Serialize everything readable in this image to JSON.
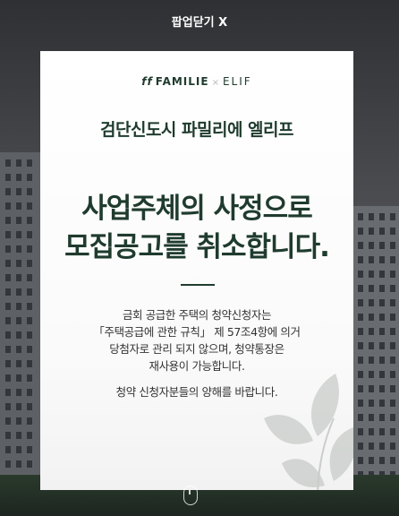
{
  "popup": {
    "close_label": "팝업닫기 X",
    "brand": {
      "ff": "ff",
      "familie": "FAMILIE",
      "separator": "×",
      "elif": "ELIF"
    },
    "site_title": "검단신도시 파밀리에 엘리프",
    "headline": {
      "line1": "사업주체의 사정으로",
      "line2": "모집공고를 취소합니다."
    },
    "body_lines": [
      "금회 공급한 주택의 청약신청자는",
      "「주택공급에 관한 규칙」 제 57조4항에 의거",
      "당첨자로 관리 되지 않으며, 청약통장은",
      "재사용이 가능합니다."
    ],
    "closing": "청약 신청자분들의 양해를 바랍니다."
  },
  "colors": {
    "brand_green": "#1f3b2e",
    "text": "#333333"
  }
}
